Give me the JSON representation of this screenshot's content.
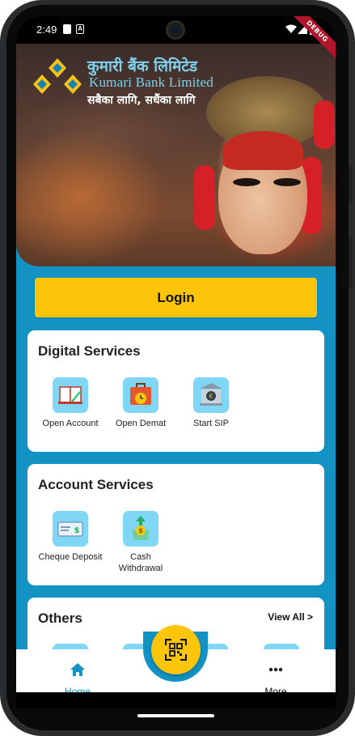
{
  "status_bar": {
    "time": "2:49",
    "debug_label": "DEBUG",
    "icons": [
      "sim-card-icon",
      "notification-icon",
      "wifi-icon",
      "signal-icon",
      "battery-icon"
    ]
  },
  "banner": {
    "logo_nepali": "कुमारी बैंक लिमिटेड",
    "logo_english": "Kumari Bank Limited",
    "tagline": "सबैका लागि, सधैंका लागि"
  },
  "login": {
    "label": "Login"
  },
  "digital_services": {
    "title": "Digital Services",
    "items": [
      {
        "label": "Open Account",
        "icon": "book-icon"
      },
      {
        "label": "Open Demat",
        "icon": "briefcase-clock-icon"
      },
      {
        "label": "Start SIP",
        "icon": "bank-euro-icon"
      }
    ]
  },
  "account_services": {
    "title": "Account Services",
    "items": [
      {
        "label": "Cheque Deposit",
        "icon": "cheque-icon"
      },
      {
        "label_line1": "Cash",
        "label_line2": "Withdrawal",
        "icon": "cash-withdrawal-icon"
      }
    ]
  },
  "others": {
    "title": "Others",
    "view_all": "View All >"
  },
  "bottom_nav": {
    "home": "Home",
    "more": "More",
    "center_icon": "qr-scan-icon"
  },
  "colors": {
    "primary_blue": "#1393c4",
    "accent_yellow": "#fcc50a",
    "icon_tile": "#7fd6f5",
    "logo_teal": "#7fd0ea"
  }
}
